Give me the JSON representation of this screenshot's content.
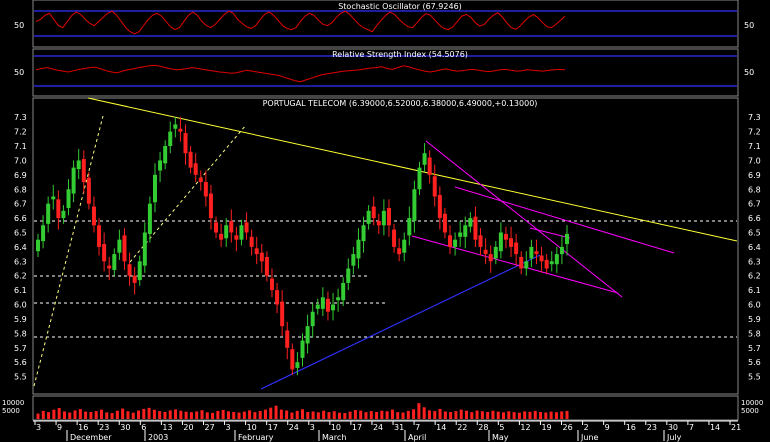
{
  "stochastic": {
    "title": "Stochastic Oscillator (67.9246)",
    "tick_label": "50",
    "upper_band": 80,
    "lower_band": 20,
    "values": [
      55,
      60,
      70,
      75,
      60,
      45,
      40,
      55,
      70,
      78,
      72,
      60,
      50,
      45,
      55,
      65,
      75,
      80,
      70,
      55,
      40,
      30,
      25,
      30,
      45,
      60,
      70,
      75,
      68,
      55,
      42,
      35,
      40,
      55,
      70,
      78,
      70,
      55,
      45,
      40,
      48,
      60,
      72,
      80,
      75,
      60,
      50,
      42,
      38,
      45,
      60,
      72,
      78,
      70,
      58,
      45,
      38,
      35,
      40,
      55,
      68,
      75,
      70,
      58,
      48,
      45,
      52,
      65,
      75,
      80,
      72,
      60,
      48,
      40,
      35,
      30,
      45,
      58,
      70,
      78,
      72,
      60,
      50,
      42,
      40,
      52,
      65,
      74,
      70,
      58,
      46,
      38,
      35,
      42,
      55,
      68,
      72,
      65,
      52,
      44,
      48,
      60,
      70,
      76,
      66,
      52,
      40,
      36,
      44,
      56,
      66,
      72,
      64,
      52,
      42,
      40,
      48,
      58,
      68
    ]
  },
  "rsi": {
    "title": "Relative Strength Index (54.5076)",
    "tick_label": "50",
    "upper_band": 70,
    "lower_band": 30,
    "values": [
      55,
      58,
      60,
      57,
      54,
      52,
      50,
      53,
      56,
      58,
      60,
      61,
      57,
      53,
      50,
      48,
      52,
      55,
      57,
      60,
      62,
      64,
      65,
      63,
      60,
      57,
      55,
      56,
      58,
      60,
      58,
      56,
      54,
      52,
      50,
      49,
      47,
      48,
      51,
      54,
      52,
      50,
      48,
      46,
      44,
      42,
      38,
      34,
      30,
      28,
      32,
      36,
      40,
      44,
      46,
      48,
      50,
      52,
      53,
      54,
      55,
      57,
      59,
      60,
      62,
      58,
      56,
      60,
      64,
      62,
      58,
      55,
      52,
      50,
      52,
      55,
      57,
      54,
      52,
      53,
      55,
      56,
      54,
      52,
      51,
      53,
      55,
      56,
      54,
      52,
      53,
      55,
      54,
      53,
      52,
      54,
      55,
      56,
      55
    ]
  },
  "price": {
    "title": "PORTUGAL TELECOM (6.39000,6.52000,6.38000,6.49000,+0.13000)",
    "y_ticks": [
      "7.3",
      "7.2",
      "7.1",
      "7.0",
      "6.9",
      "6.8",
      "6.7",
      "6.6",
      "6.5",
      "6.4",
      "6.3",
      "6.2",
      "6.1",
      "6.0",
      "5.9",
      "5.8",
      "5.7",
      "5.6",
      "5.5"
    ],
    "closes": [
      6.45,
      6.55,
      6.7,
      6.75,
      6.6,
      6.65,
      6.8,
      6.95,
      7.0,
      6.85,
      6.7,
      6.55,
      6.4,
      6.3,
      6.25,
      6.35,
      6.45,
      6.3,
      6.2,
      6.15,
      6.3,
      6.5,
      6.7,
      6.9,
      7.0,
      7.1,
      7.2,
      7.25,
      7.2,
      7.05,
      6.95,
      6.9,
      6.85,
      6.75,
      6.6,
      6.5,
      6.45,
      6.55,
      6.5,
      6.45,
      6.55,
      6.5,
      6.4,
      6.35,
      6.3,
      6.2,
      6.1,
      6.0,
      5.85,
      5.7,
      5.55,
      5.6,
      5.75,
      5.85,
      5.95,
      6.0,
      6.05,
      5.95,
      6.0,
      6.05,
      6.15,
      6.25,
      6.35,
      6.45,
      6.55,
      6.65,
      6.6,
      6.55,
      6.65,
      6.55,
      6.4,
      6.35,
      6.45,
      6.6,
      6.8,
      6.95,
      7.05,
      6.9,
      6.75,
      6.6,
      6.5,
      6.4,
      6.45,
      6.5,
      6.55,
      6.6,
      6.45,
      6.4,
      6.35,
      6.3,
      6.4,
      6.5,
      6.45,
      6.4,
      6.35,
      6.25,
      6.3,
      6.4,
      6.35,
      6.3,
      6.25,
      6.3,
      6.35,
      6.4,
      6.49
    ]
  },
  "volume": {
    "y_ticks": [
      "10000",
      "5000"
    ],
    "values": [
      3000,
      4500,
      3800,
      5200,
      6100,
      4200,
      3600,
      4800,
      5500,
      4100,
      3900,
      4400,
      5200,
      3700,
      3300,
      4600,
      5800,
      4300,
      3500,
      4700,
      5600,
      6200,
      5100,
      4400,
      3900,
      4800,
      5300,
      4600,
      4100,
      3800,
      4200,
      4900,
      3700,
      3400,
      4500,
      5000,
      4300,
      3900,
      3600,
      4100,
      4800,
      3800,
      4400,
      5200,
      6300,
      7400,
      5200,
      4700,
      3600,
      4500,
      5400,
      3900,
      4200,
      3700,
      4600,
      3800,
      4300,
      3500,
      3300,
      4100,
      5000,
      4700,
      3800,
      4400,
      3900,
      4600,
      4300,
      5200,
      3800,
      3600,
      4500,
      5400,
      8800,
      6500,
      4800,
      4400,
      5600,
      4200,
      3900,
      4400,
      5200,
      4600,
      3800,
      4700,
      4300,
      3900,
      4600,
      4100,
      3700,
      4300,
      3800,
      3500,
      4200,
      4000,
      4500,
      3900,
      3600,
      4100,
      3800,
      4200,
      4500
    ]
  },
  "x_axis": {
    "day_labels": [
      "3",
      "9",
      "16",
      "23",
      "30",
      "6",
      "13",
      "20",
      "27",
      "3",
      "10",
      "17",
      "24",
      "3",
      "10",
      "17",
      "24",
      "31",
      "7",
      "14",
      "22",
      "28",
      "5",
      "12",
      "19",
      "26",
      "2",
      "9",
      "16",
      "23",
      "30",
      "7",
      "14",
      "21"
    ],
    "month_labels": [
      "December",
      "2003",
      "February",
      "March",
      "April",
      "May",
      "June",
      "July"
    ]
  },
  "chart_data": [
    {
      "type": "line",
      "title": "Stochastic Oscillator (67.9246)",
      "ylabel": "",
      "ylim": [
        0,
        100
      ],
      "bands": [
        80,
        20
      ],
      "series": [
        {
          "values_ref": "stochastic.values"
        }
      ]
    },
    {
      "type": "line",
      "title": "Relative Strength Index (54.5076)",
      "ylim": [
        0,
        100
      ],
      "bands": [
        70,
        30
      ]
    },
    {
      "type": "bar",
      "title": "PORTUGAL TELECOM (6.39000,6.52000,6.38000,6.49000,+0.13000)",
      "ylim": [
        5.4,
        7.35
      ],
      "last_bar": {
        "open": 6.39,
        "high": 6.52,
        "low": 6.38,
        "close": 6.49,
        "change": 0.13
      },
      "support_levels": [
        6.5,
        6.12,
        5.95,
        5.74
      ]
    }
  ]
}
